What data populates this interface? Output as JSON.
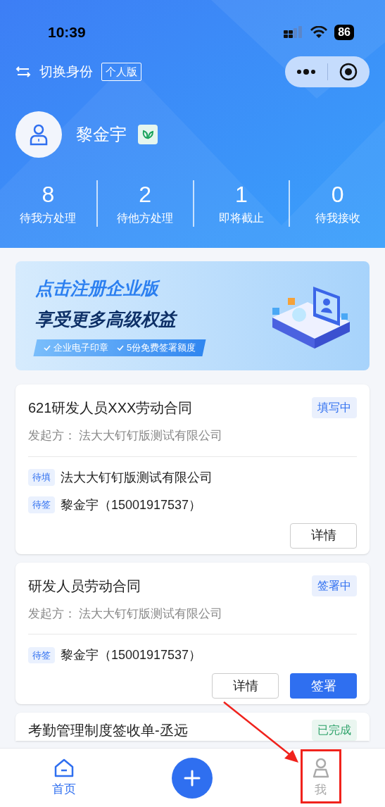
{
  "status_bar": {
    "time": "10:39",
    "battery": "86"
  },
  "header": {
    "switch_label": "切换身份",
    "edition_badge": "个人版"
  },
  "profile": {
    "name": "黎金宇"
  },
  "stats": [
    {
      "value": "8",
      "label": "待我方处理"
    },
    {
      "value": "2",
      "label": "待他方处理"
    },
    {
      "value": "1",
      "label": "即将截止"
    },
    {
      "value": "0",
      "label": "待我接收"
    }
  ],
  "banner": {
    "title": "点击注册企业版",
    "subtitle": "享受更多高级权益",
    "features": [
      "企业电子印章",
      "5份免费签署额度"
    ]
  },
  "contracts": [
    {
      "title": "621研发人员XXX劳动合同",
      "status": "填写中",
      "color": "#2f6ff0",
      "initiator_label": "发起方：",
      "initiator": "法大大钉钉版测试有限公司",
      "signers": [
        {
          "role": "待填",
          "name": "法大大钉钉版测试有限公司"
        },
        {
          "role": "待签",
          "name": "黎金宇（15001917537）"
        }
      ],
      "buttons": [
        {
          "label": "详情",
          "primary": false
        }
      ]
    },
    {
      "title": "研发人员劳动合同",
      "status": "签署中",
      "color": "#2f6ff0",
      "initiator_label": "发起方：",
      "initiator": "法大大钉钉版测试有限公司",
      "signers": [
        {
          "role": "待签",
          "name": "黎金宇（15001917537）"
        }
      ],
      "buttons": [
        {
          "label": "详情",
          "primary": false
        },
        {
          "label": "签署",
          "primary": true
        }
      ]
    },
    {
      "title": "考勤管理制度签收单-丞远",
      "status": "已完成",
      "color": "#2fa36b"
    }
  ],
  "tab_bar": [
    {
      "kind": "home",
      "label": "首页",
      "selected": true
    },
    {
      "kind": "add",
      "selected": false
    },
    {
      "kind": "me",
      "label": "我",
      "selected": false
    }
  ]
}
